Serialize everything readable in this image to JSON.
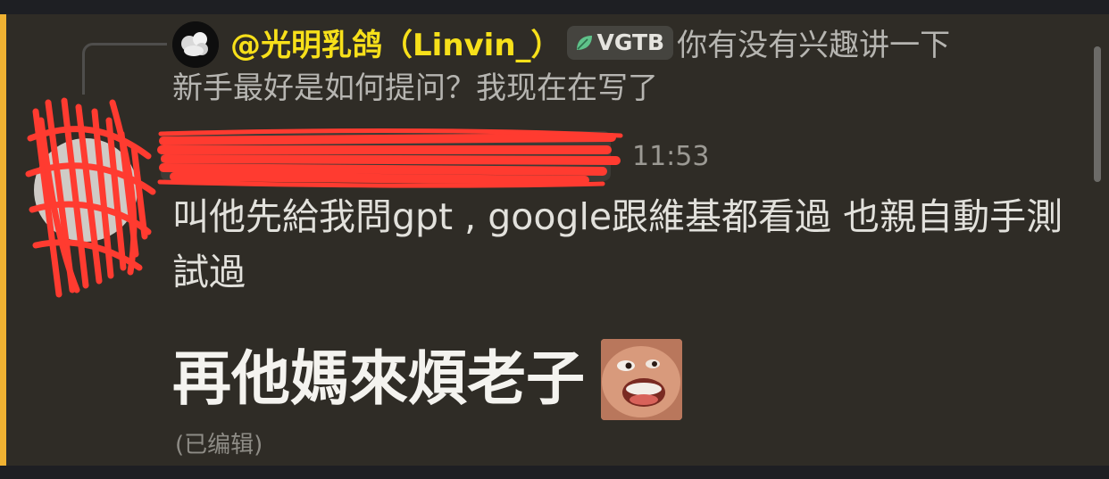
{
  "reply": {
    "author": "@光明乳鸽（Linvin_）",
    "badge": "VGTB",
    "content_line1": "你有没有兴趣讲一下",
    "content_line2": "新手最好是如何提问？我现在在写了"
  },
  "message": {
    "timestamp": "11:53",
    "text": "叫他先給我問gpt , google跟維基都看過  也親自動手測試過",
    "big_text": "再他媽來煩老子",
    "edited_label": "(已编辑)"
  },
  "colors": {
    "background": "#2f2c26",
    "mention_bar": "#f0b232",
    "author_name": "#f7e01a",
    "redaction": "#ff3b30",
    "badge_leaf": "#5fc28a"
  },
  "icons": {
    "reply_avatar": "avatar-icon",
    "badge_leaf": "leaf-icon",
    "emoji": "laughing-face-emoji"
  }
}
